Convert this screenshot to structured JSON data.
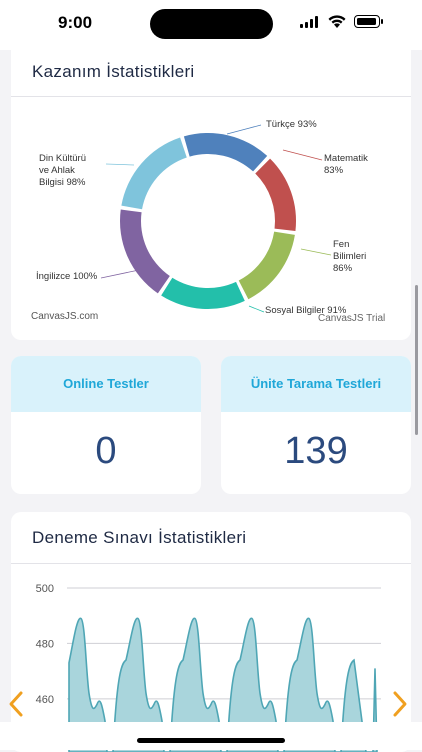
{
  "status_bar": {
    "time": "9:00"
  },
  "achievement_card": {
    "title": "Kazanım İstatistikleri",
    "credit_left": "CanvasJS.com",
    "credit_right": "CanvasJS Trial",
    "chart_data": {
      "type": "pie",
      "subtype": "doughnut",
      "categories": [
        "Türkçe",
        "Matematik",
        "Fen Bilimleri",
        "Sosyal Bilgiler",
        "İngilizce",
        "Din Kültürü ve Ahlak Bilgisi"
      ],
      "values": [
        93,
        83,
        86,
        91,
        100,
        98
      ],
      "colors": [
        "#4f81bc",
        "#c0504e",
        "#9bbb58",
        "#23bfaa",
        "#8064a1",
        "#7fc4dc"
      ],
      "labels": [
        "Türkçe 93%",
        "Matematik 83%",
        "Fen Bilimleri 86%",
        "Sosyal Bilgiler 91%",
        "İngilizce 100%",
        "Din Kültürü ve Ahlak Bilgisi 98%"
      ]
    },
    "label_lines": {
      "turkce": [
        "Türkçe 93%"
      ],
      "matematik": [
        "Matematik",
        "83%"
      ],
      "fen": [
        "Fen",
        "Bilimleri",
        "86%"
      ],
      "sosyal": [
        "Sosyal Bilgiler 91%"
      ],
      "ingilizce": [
        "İngilizce 100%"
      ],
      "din": [
        "Din Kültürü",
        "ve Ahlak",
        "Bilgisi 98%"
      ]
    }
  },
  "online_tests": {
    "label": "Online Testler",
    "value": "0"
  },
  "unit_tests": {
    "label": "Ünite Tarama Testleri",
    "value": "139"
  },
  "exam_card": {
    "title": "Deneme Sınavı İstatistikleri",
    "chart_data": {
      "type": "area",
      "y_ticks": [
        500,
        480,
        460
      ],
      "ylim": [
        452,
        500
      ],
      "grid": true,
      "color": "#5fb0be"
    }
  },
  "icons": {
    "left_arrow": "chevron-left-icon",
    "right_arrow": "chevron-right-icon",
    "arrow_color": "#f0a020"
  }
}
